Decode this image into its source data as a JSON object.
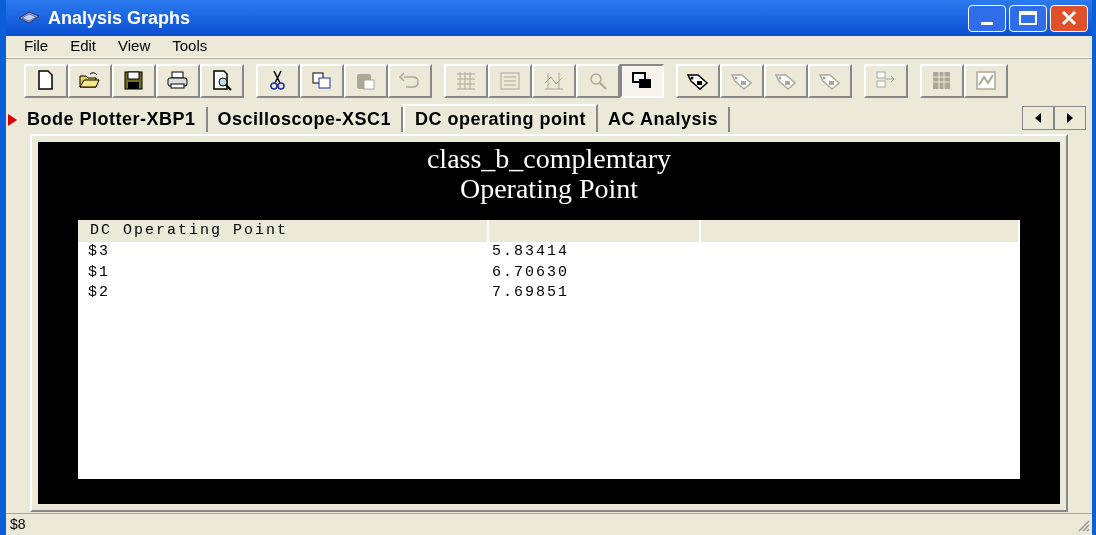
{
  "window": {
    "title": "Analysis Graphs"
  },
  "menu": [
    "File",
    "Edit",
    "View",
    "Tools"
  ],
  "toolbar": [
    [
      {
        "kind": "new",
        "disabled": false,
        "selected": false
      },
      {
        "kind": "open",
        "disabled": false,
        "selected": false
      },
      {
        "kind": "save",
        "disabled": false,
        "selected": false
      },
      {
        "kind": "print",
        "disabled": false,
        "selected": false
      },
      {
        "kind": "preview",
        "disabled": false,
        "selected": false
      }
    ],
    [
      {
        "kind": "cut",
        "disabled": false,
        "selected": false
      },
      {
        "kind": "copy",
        "disabled": false,
        "selected": false
      },
      {
        "kind": "paste",
        "disabled": true,
        "selected": false
      },
      {
        "kind": "undo",
        "disabled": true,
        "selected": false
      }
    ],
    [
      {
        "kind": "grid",
        "disabled": true,
        "selected": false
      },
      {
        "kind": "legend",
        "disabled": true,
        "selected": false
      },
      {
        "kind": "cursors",
        "disabled": true,
        "selected": false
      },
      {
        "kind": "zoom",
        "disabled": true,
        "selected": false
      },
      {
        "kind": "overlay",
        "disabled": false,
        "selected": true
      }
    ],
    [
      {
        "kind": "tag",
        "disabled": false,
        "selected": false
      },
      {
        "kind": "tag",
        "disabled": true,
        "selected": false
      },
      {
        "kind": "tag",
        "disabled": true,
        "selected": false
      },
      {
        "kind": "tag",
        "disabled": true,
        "selected": false
      }
    ],
    [
      {
        "kind": "export",
        "disabled": true,
        "selected": false
      }
    ],
    [
      {
        "kind": "sheet",
        "disabled": true,
        "selected": false
      },
      {
        "kind": "chart",
        "disabled": true,
        "selected": false
      }
    ]
  ],
  "tabs": [
    {
      "label": "Bode Plotter-XBP1",
      "selected": false,
      "marked": true
    },
    {
      "label": "Oscilloscope-XSC1",
      "selected": false,
      "marked": false
    },
    {
      "label": "DC operating point",
      "selected": true,
      "marked": false
    },
    {
      "label": "AC Analysis",
      "selected": false,
      "marked": false
    }
  ],
  "graph": {
    "title": "class_b_complemtary",
    "subtitle": "Operating Point",
    "table": {
      "columns": [
        "DC Operating Point"
      ],
      "rows": [
        [
          "$3",
          "5.83414"
        ],
        [
          "$1",
          "6.70630"
        ],
        [
          "$2",
          "7.69851"
        ]
      ]
    }
  },
  "status_bar": "$8"
}
